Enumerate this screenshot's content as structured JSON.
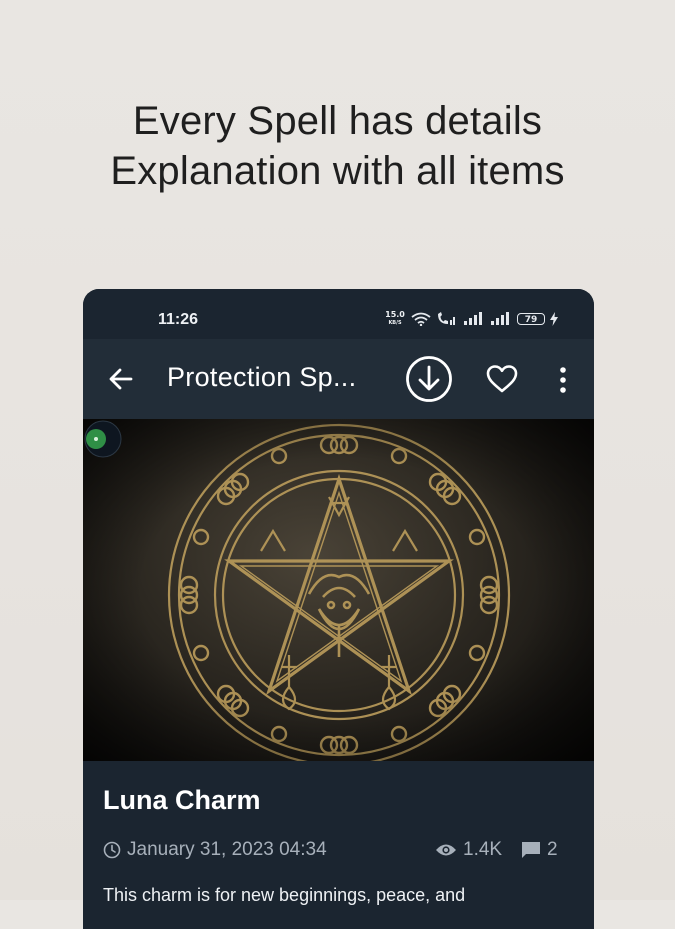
{
  "headline": {
    "line1": "Every Spell has details",
    "line2": "Explanation with all items"
  },
  "status_bar": {
    "time": "11:26",
    "net_speed_value": "15.0",
    "net_speed_unit": "KB/S",
    "battery": "79"
  },
  "app_bar": {
    "title": "Protection Sp...",
    "back_icon": "arrow-back-icon",
    "download_icon": "download-circle-icon",
    "favorite_icon": "heart-outline-icon",
    "more_icon": "more-vert-icon"
  },
  "article": {
    "title": "Luna Charm",
    "date": "January 31, 2023 04:34",
    "views": "1.4K",
    "comments": "2",
    "description": "This charm is for new beginnings, peace, and"
  },
  "colors": {
    "page_bg": "#e8e4e0",
    "phone_bg": "#1b2530",
    "appbar_bg": "#222d38",
    "meta_text": "#a7b0ba",
    "sigil_gold": "#b89a5a"
  }
}
